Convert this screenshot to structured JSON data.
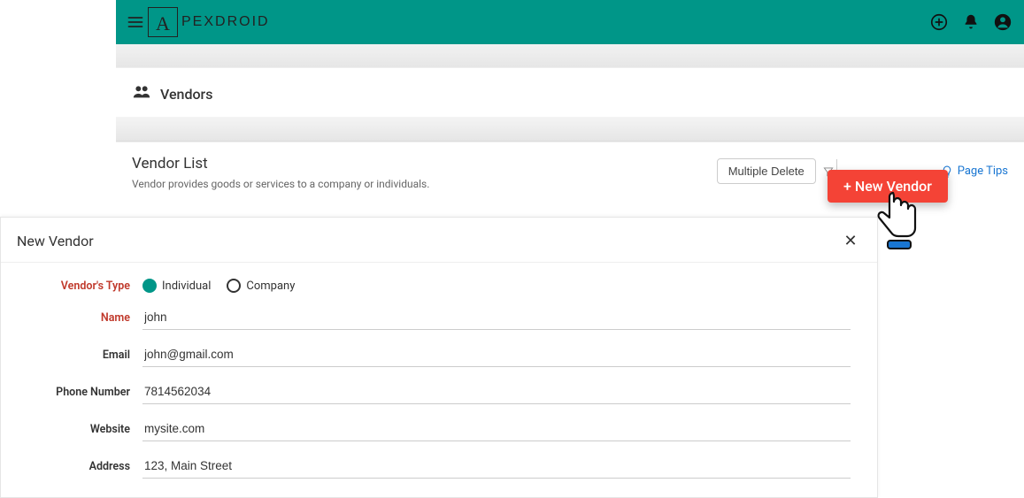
{
  "brand": {
    "logo_letter": "A",
    "name": "PEXDROID"
  },
  "page": {
    "title": "Vendors",
    "list_title": "Vendor List",
    "list_subtitle": "Vendor provides goods or services to a company or individuals.",
    "multiple_delete": "Multiple Delete",
    "page_tips": "Page Tips",
    "new_vendor_btn": "+ New Vendor"
  },
  "modal": {
    "title": "New Vendor",
    "labels": {
      "vendors_type": "Vendor's Type",
      "name": "Name",
      "email": "Email",
      "phone": "Phone Number",
      "website": "Website",
      "address": "Address"
    },
    "type_options": {
      "individual": "Individual",
      "company": "Company"
    },
    "values": {
      "name": "john",
      "email": "john@gmail.com",
      "phone": "7814562034",
      "website": "mysite.com",
      "address": "123, Main Street"
    }
  }
}
